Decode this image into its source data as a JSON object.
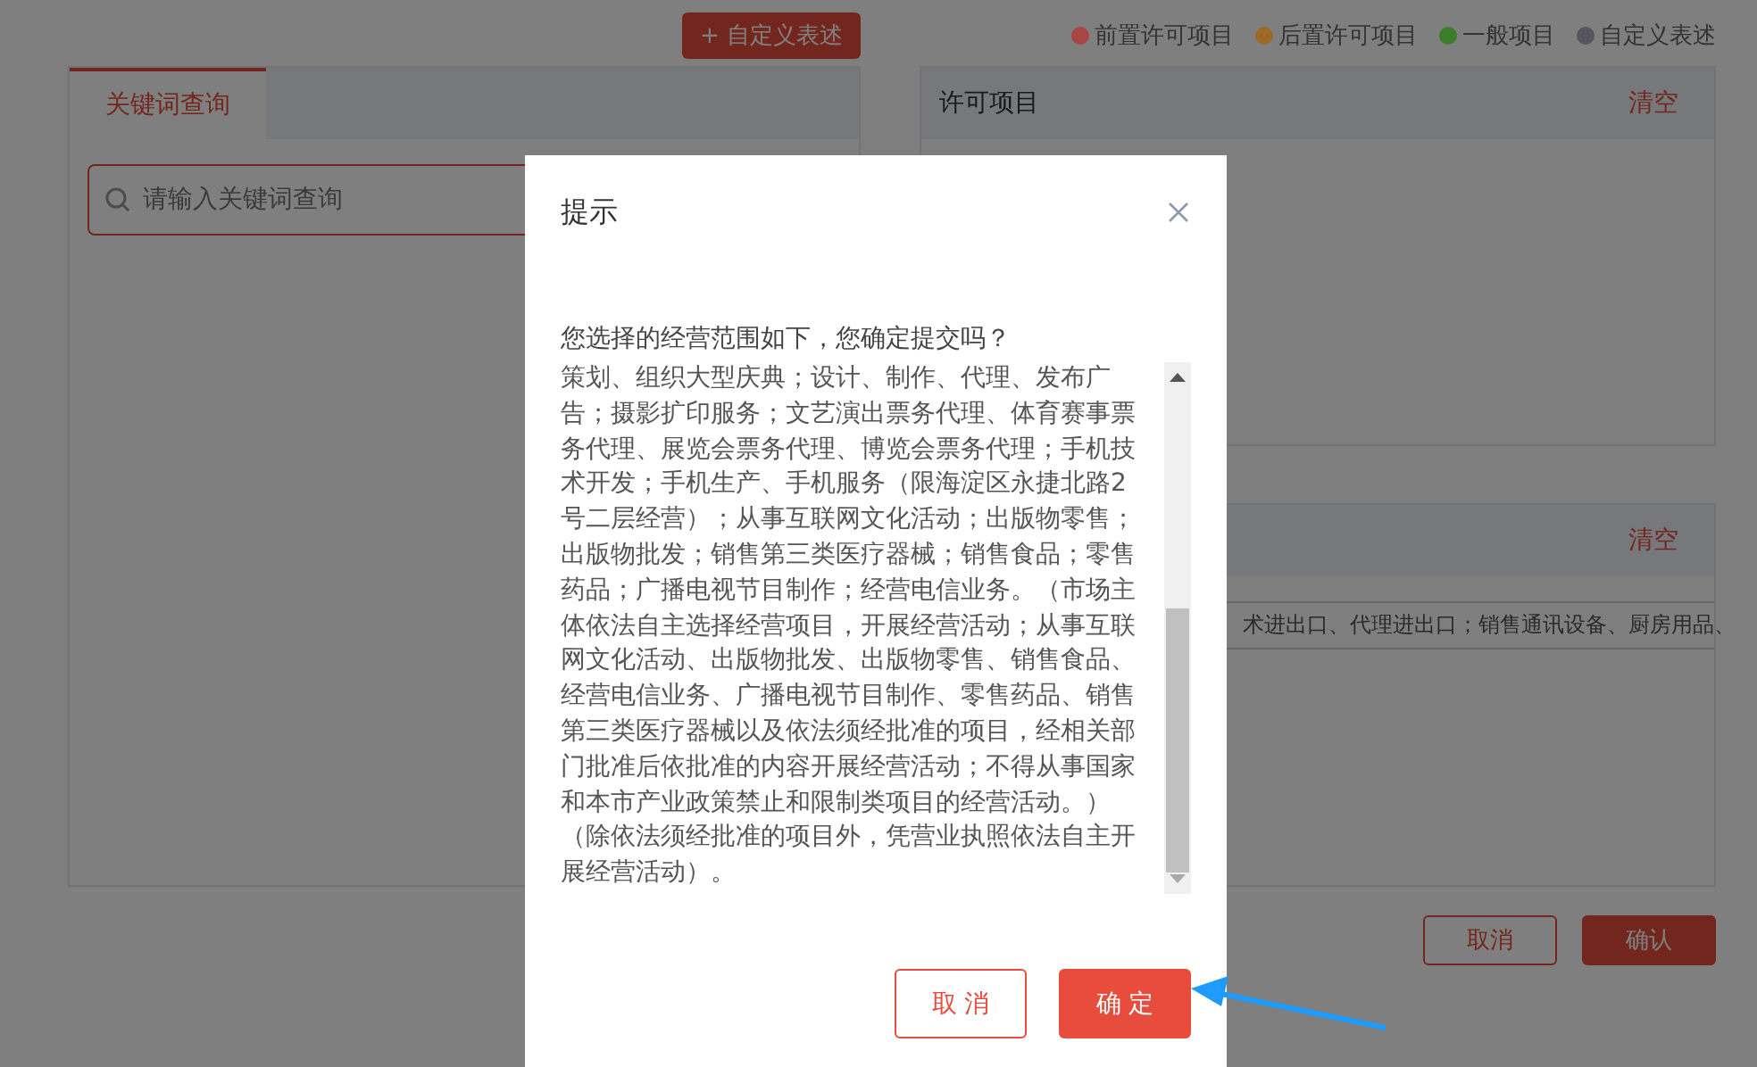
{
  "toolbar": {
    "add_button": "+ 自定义表述"
  },
  "legend": [
    {
      "label": "前置许可项目",
      "color": "#a94545"
    },
    {
      "label": "后置许可项目",
      "color": "#9c6a25"
    },
    {
      "label": "一般项目",
      "color": "#3c7d2a"
    },
    {
      "label": "自定义表述",
      "color": "#55555a"
    }
  ],
  "keyword_panel": {
    "tabs": [
      {
        "label": "关键词查询",
        "selected": true
      }
    ],
    "search": {
      "placeholder": "请输入关键词查询"
    }
  },
  "permit_panel": {
    "title": "许可项目",
    "clear": "清空"
  },
  "general_panel": {
    "clear": "清空",
    "row_text": "术进出口、代理进出口；销售通讯设备、厨房用品、"
  },
  "footer_buttons": [
    {
      "label": "取消",
      "kind": "outline"
    },
    {
      "label": "确认",
      "kind": "primary"
    }
  ],
  "dialog": {
    "title": "提示",
    "intro": "您选择的经营范围如下，您确定提交吗？",
    "scope_text": "策划、组织大型庆典；设计、制作、代理、发布广告；摄影扩印服务；文艺演出票务代理、体育赛事票务代理、展览会票务代理、博览会票务代理；手机技术开发；手机生产、手机服务（限海淀区永捷北路2号二层经营）；从事互联网文化活动；出版物零售；出版物批发；销售第三类医疗器械；销售食品；零售药品；广播电视节目制作；经营电信业务。（市场主体依法自主选择经营项目，开展经营活动；从事互联网文化活动、出版物批发、出版物零售、销售食品、经营电信业务、广播电视节目制作、零售药品、销售第三类医疗器械以及依法须经批准的项目，经相关部门批准后依批准的内容开展经营活动；不得从事国家和本市产业政策禁止和限制类项目的经营活动。）（除依法须经批准的项目外，凭营业执照依法自主开展经营活动）。",
    "buttons": [
      {
        "label": "取 消",
        "kind": "outline"
      },
      {
        "label": "确 定",
        "kind": "primary"
      }
    ]
  }
}
